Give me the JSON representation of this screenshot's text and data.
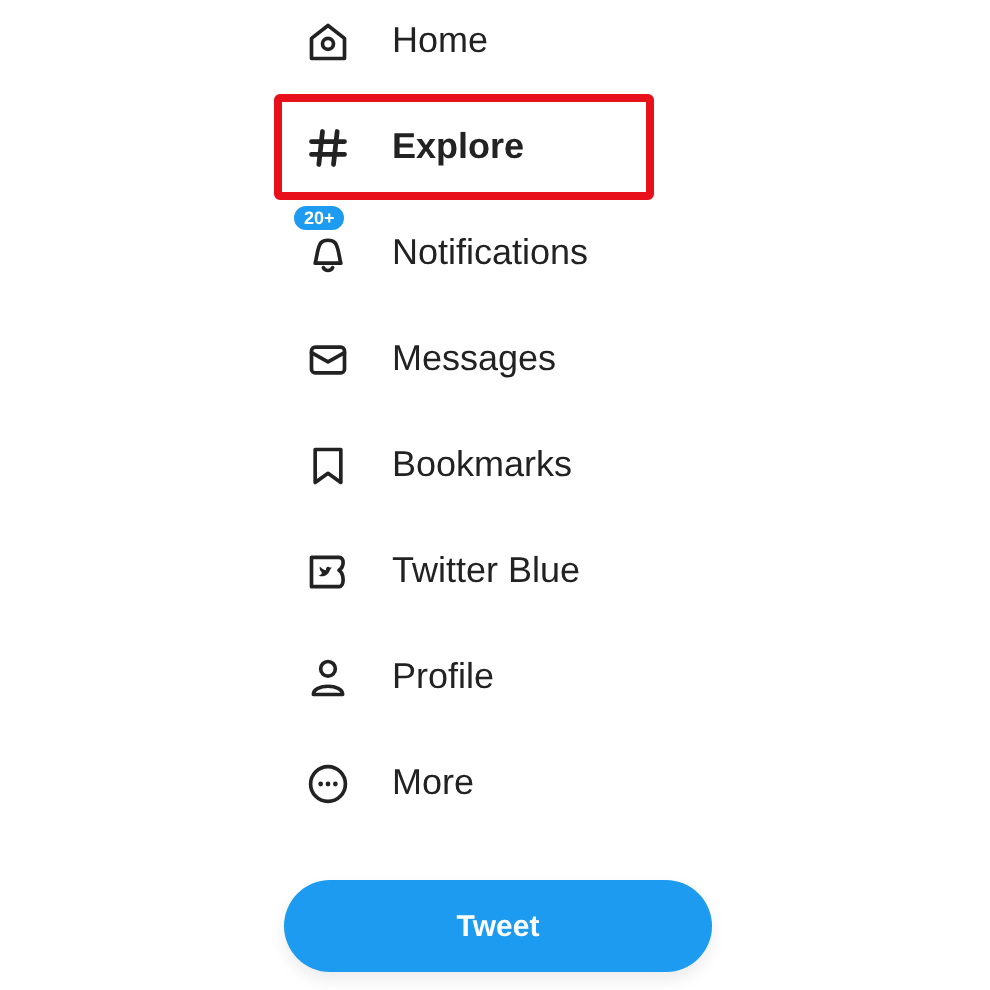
{
  "nav": [
    {
      "label": "Home",
      "selected": false,
      "highlighted": false
    },
    {
      "label": "Explore",
      "selected": true,
      "highlighted": true
    },
    {
      "label": "Notifications",
      "selected": false,
      "highlighted": false,
      "badge": "20+"
    },
    {
      "label": "Messages",
      "selected": false,
      "highlighted": false
    },
    {
      "label": "Bookmarks",
      "selected": false,
      "highlighted": false
    },
    {
      "label": "Twitter Blue",
      "selected": false,
      "highlighted": false
    },
    {
      "label": "Profile",
      "selected": false,
      "highlighted": false
    },
    {
      "label": "More",
      "selected": false,
      "highlighted": false
    }
  ],
  "tweet_button": "Tweet"
}
